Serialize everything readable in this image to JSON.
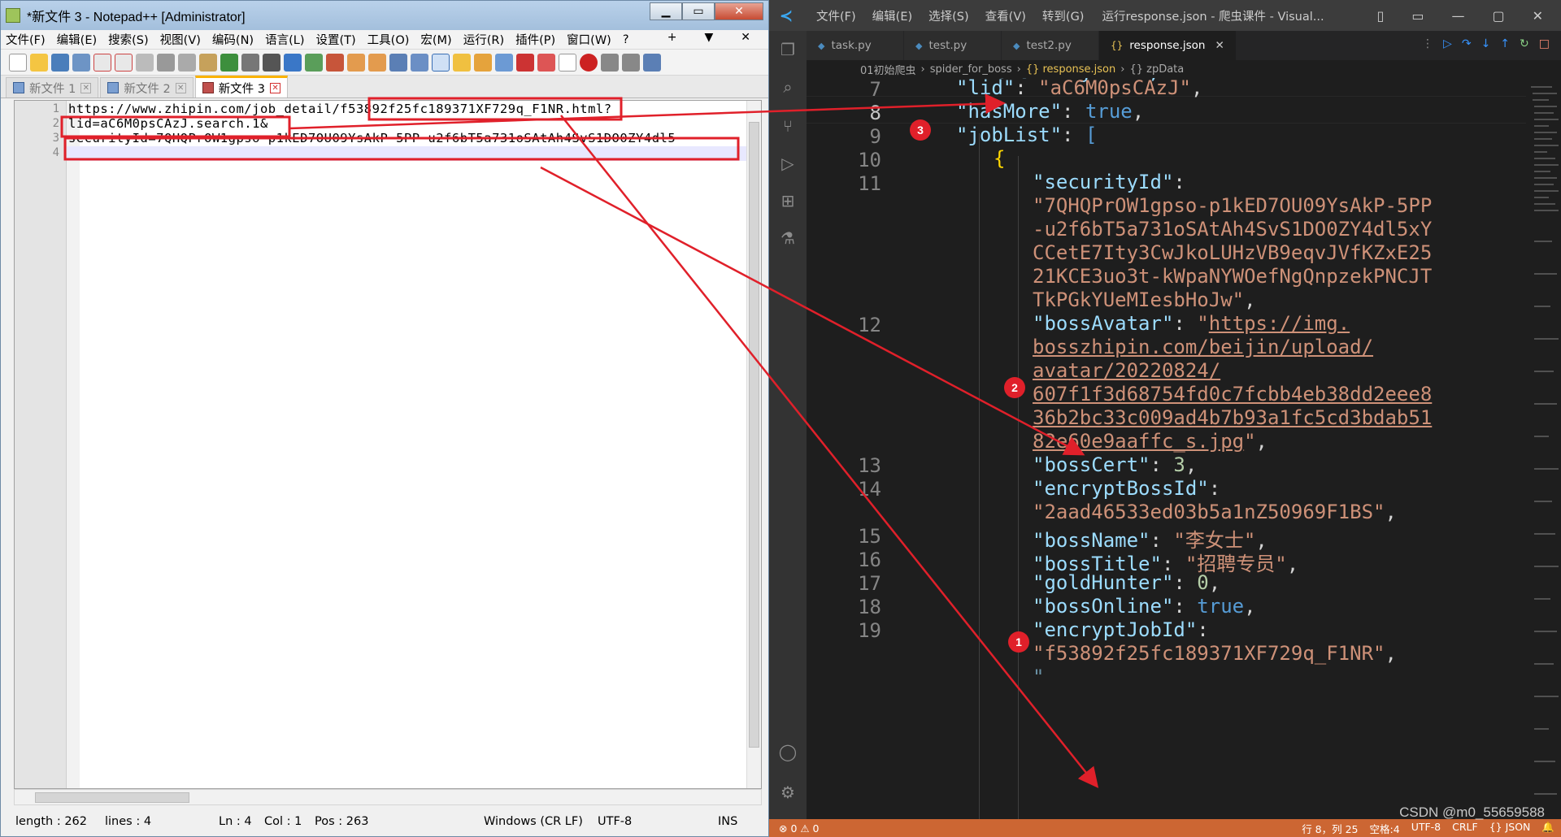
{
  "notepad": {
    "title": "*新文件 3 - Notepad++ [Administrator]",
    "menu": [
      "文件(F)",
      "编辑(E)",
      "搜索(S)",
      "视图(V)",
      "编码(N)",
      "语言(L)",
      "设置(T)",
      "工具(O)",
      "宏(M)",
      "运行(R)",
      "插件(P)",
      "窗口(W)",
      "?"
    ],
    "menu_right": [
      "+",
      "▼",
      "✕"
    ],
    "tabs": [
      {
        "label": "新文件 1",
        "active": false
      },
      {
        "label": "新文件 2",
        "active": false
      },
      {
        "label": "新文件 3",
        "active": true
      }
    ],
    "lines": [
      {
        "num": "1",
        "text": "https://www.zhipin.com/job_detail/f53892f25fc189371XF729q_F1NR.html?"
      },
      {
        "num": "2",
        "text": "lid=aC6M0psCAzJ.search.1&"
      },
      {
        "num": "3",
        "text": "securityId=7QHQPrOW1gpso-p1kED7OU09YsAkP-5PP-u2f6bT5a731oSAtAh4SvS1DO0ZY4dl5"
      },
      {
        "num": "4",
        "text": ""
      }
    ],
    "status": {
      "length": "length : 262",
      "lines": "lines : 4",
      "ln": "Ln : 4",
      "col": "Col : 1",
      "pos": "Pos : 263",
      "eol": "Windows (CR LF)",
      "encoding": "UTF-8",
      "mode": "INS"
    }
  },
  "vscode": {
    "menu": [
      "文件(F)",
      "编辑(E)",
      "选择(S)",
      "查看(V)",
      "转到(G)"
    ],
    "title": "运行response.json - 爬虫课件 - Visual...",
    "tabs": [
      {
        "label": "task.py",
        "active": false,
        "icon": "python-icon"
      },
      {
        "label": "test.py",
        "active": false,
        "icon": "python-icon"
      },
      {
        "label": "test2.py",
        "active": false,
        "icon": "python-icon"
      },
      {
        "label": "response.json",
        "active": true,
        "icon": "json-icon"
      }
    ],
    "breadcrumb": [
      "01初始爬虫",
      "spider_for_boss",
      "{} response.json",
      "{} zpData"
    ],
    "line_numbers": [
      "7",
      "8",
      "9",
      "10",
      "11",
      "12",
      "13",
      "14",
      "15",
      "16",
      "17",
      "18",
      "19"
    ],
    "json_lines": {
      "l7_key": "\"lid\"",
      "l7_val": "\"aC6M0psCAzJ\"",
      "l8_key": "\"hasMore\"",
      "l8_val": "true",
      "l9_key": "\"jobList\"",
      "l9_val": "[",
      "l10": "{",
      "l11_key": "\"securityId\"",
      "l11_v1": "\"7QHQPrOW1gpso-p1kED7OU09YsAkP-5PP",
      "l11_v2": "-u2f6bT5a731oSAtAh4SvS1DO0ZY4dl5xY",
      "l11_v3": "CCetE7Ity3CwJkoLUHzVB9eqvJVfKZxE25",
      "l11_v4": "21KCE3uo3t-kWpaNYWOefNgQnpzekPNCJT",
      "l11_v5": "TkPGkYUeMIesbHoJw\"",
      "l12_key": "\"bossAvatar\"",
      "l12_v1": "https://img.",
      "l12_v2": "bosszhipin.com/beijin/upload/",
      "l12_v3": "avatar/20220824/",
      "l12_v4": "607f1f3d68754fd0c7fcbb4eb38dd2eee8",
      "l12_v5": "36b2bc33c009ad4b7b93a1fc5cd3bdab51",
      "l12_v6": "82e60e9aaffc_s.jpg",
      "l13_key": "\"bossCert\"",
      "l13_val": "3",
      "l14_key": "\"encryptBossId\"",
      "l14_val": "\"2aad46533ed03b5a1nZ50969F1BS\"",
      "l15_key": "\"bossName\"",
      "l15_val": "\"李女士\"",
      "l16_key": "\"bossTitle\"",
      "l16_val": "\"招聘专员\"",
      "l17_key": "\"goldHunter\"",
      "l17_val": "0",
      "l18_key": "\"bossOnline\"",
      "l18_val": "true",
      "l19_key": "\"encryptJobId\"",
      "l19_val": "\"f53892f25fc189371XF729q_F1NR\""
    },
    "status": {
      "left": "⊗ 0 ⚠ 0",
      "pos": "行 8，列 25",
      "spaces": "空格:4",
      "encoding": "UTF-8",
      "eol": "CRLF",
      "lang": "{} JSON"
    }
  },
  "annotations": {
    "badge1": "1",
    "badge2": "2",
    "badge3": "3",
    "accent": "#e0202a"
  },
  "watermark": "CSDN @m0_55659588"
}
